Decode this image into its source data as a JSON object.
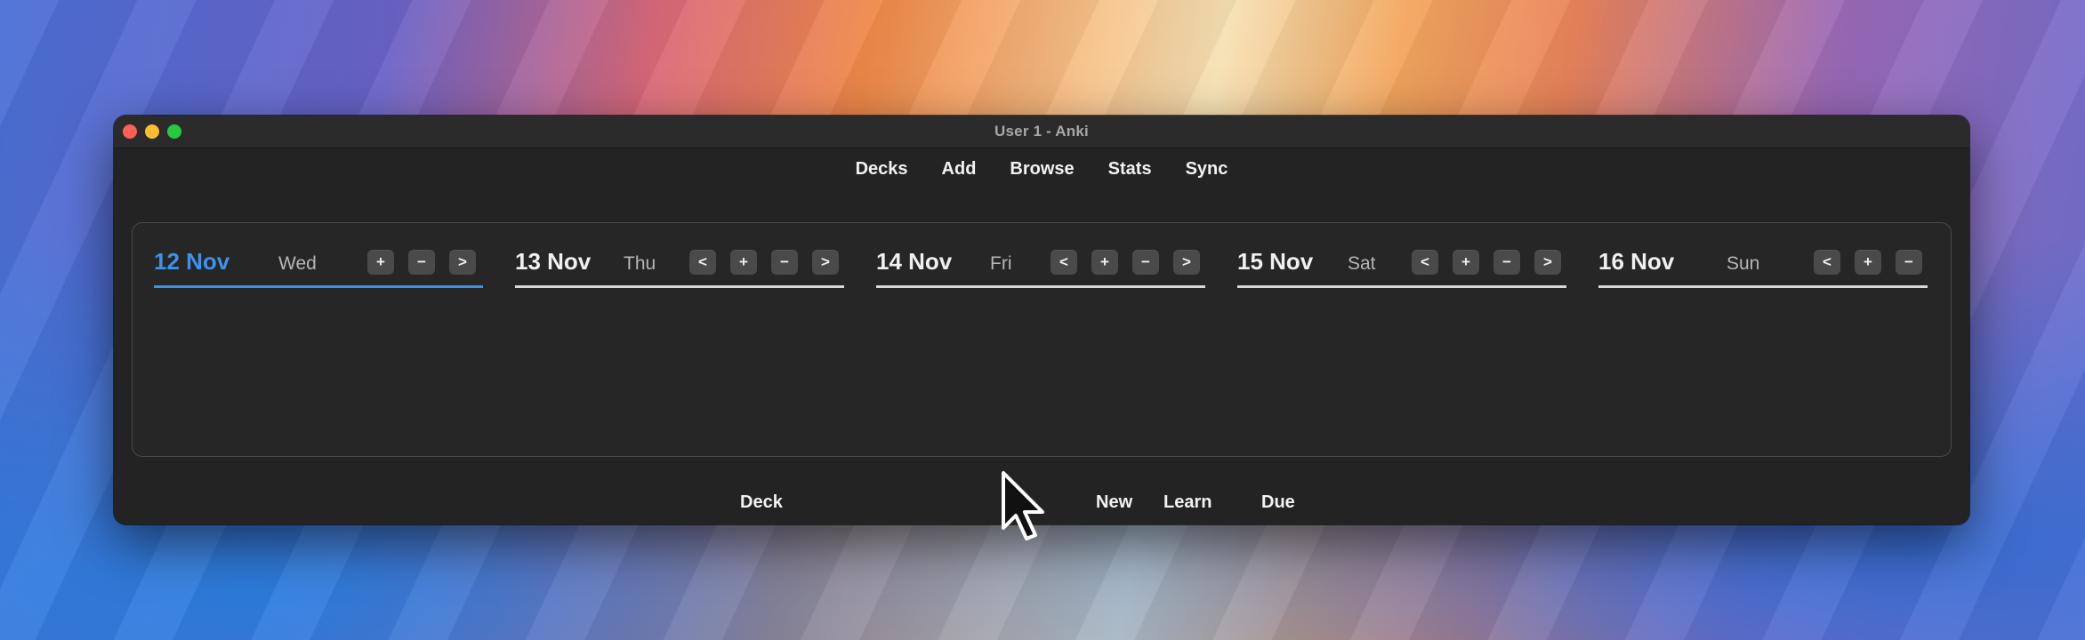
{
  "window": {
    "title": "User 1 - Anki"
  },
  "toolbar": {
    "items": [
      {
        "label": "Decks"
      },
      {
        "label": "Add"
      },
      {
        "label": "Browse"
      },
      {
        "label": "Stats"
      },
      {
        "label": "Sync"
      }
    ]
  },
  "calendar": {
    "days": [
      {
        "date": "12 Nov",
        "weekday": "Wed",
        "active": true,
        "controls": [
          "+",
          "−",
          ">"
        ]
      },
      {
        "date": "13 Nov",
        "weekday": "Thu",
        "active": false,
        "controls": [
          "<",
          "+",
          "−",
          ">"
        ]
      },
      {
        "date": "14 Nov",
        "weekday": "Fri",
        "active": false,
        "controls": [
          "<",
          "+",
          "−",
          ">"
        ]
      },
      {
        "date": "15 Nov",
        "weekday": "Sat",
        "active": false,
        "controls": [
          "<",
          "+",
          "−",
          ">"
        ]
      },
      {
        "date": "16 Nov",
        "weekday": "Sun",
        "active": false,
        "controls": [
          "<",
          "+",
          "−"
        ]
      }
    ]
  },
  "deck_table": {
    "headers": {
      "deck": "Deck",
      "new": "New",
      "learn": "Learn",
      "due": "Due"
    }
  },
  "colors": {
    "accent": "#3f90e8",
    "window_bg": "#232323",
    "button_bg": "#4a4a4a"
  },
  "icons": {
    "close": "close-icon",
    "minimize": "minimize-icon",
    "maximize": "maximize-icon",
    "cursor": "arrow-cursor-icon"
  }
}
